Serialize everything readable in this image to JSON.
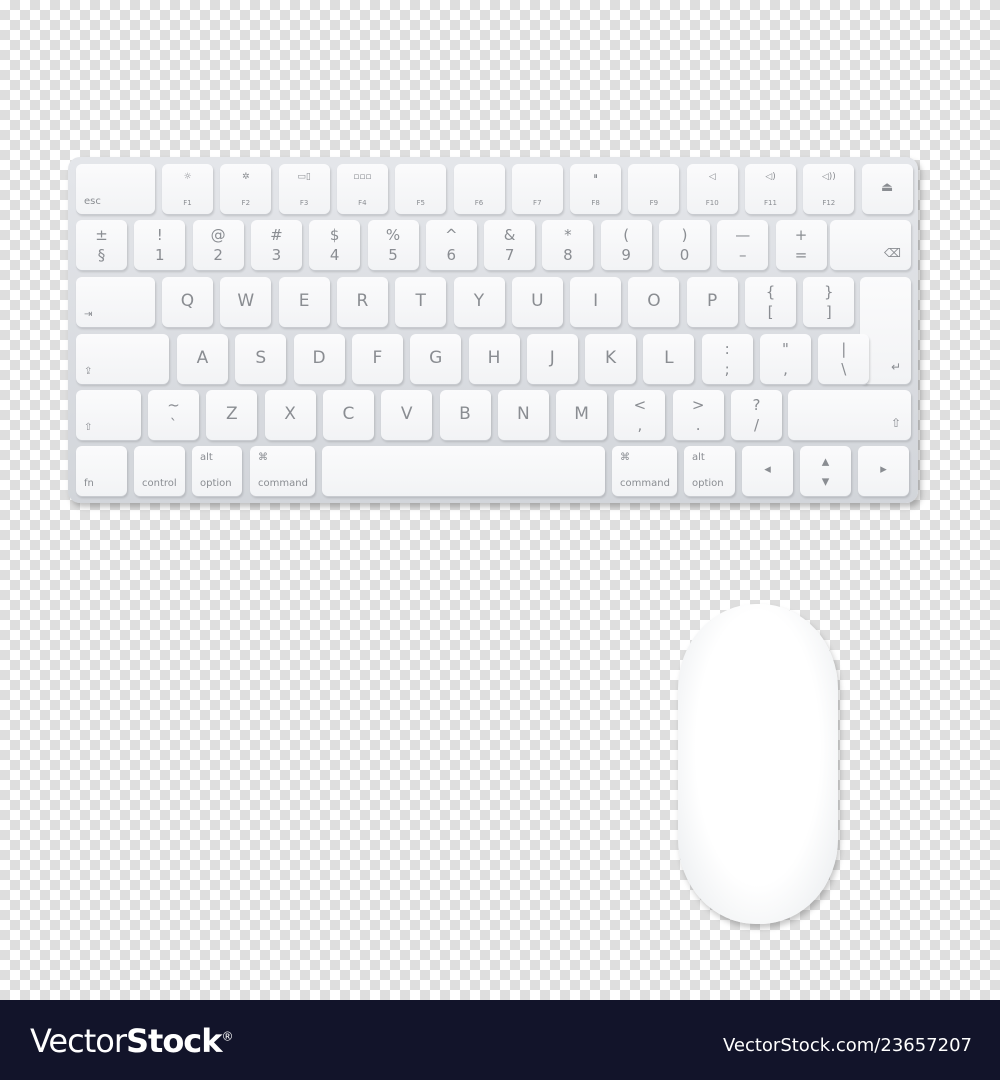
{
  "keyboard": {
    "rows": [
      [
        {
          "bl": "esc"
        },
        {
          "fn": "F1",
          "ico": "☼"
        },
        {
          "fn": "F2",
          "ico": "✲"
        },
        {
          "fn": "F3",
          "ico": "▭▯"
        },
        {
          "fn": "F4",
          "ico": "▫▫▫"
        },
        {
          "fn": "F5"
        },
        {
          "fn": "F6"
        },
        {
          "fn": "F7"
        },
        {
          "fn": "F8",
          "ico": "⏸"
        },
        {
          "fn": "F9"
        },
        {
          "fn": "F10",
          "ico": "◁"
        },
        {
          "fn": "F11",
          "ico": "◁)"
        },
        {
          "fn": "F12",
          "ico": "◁))"
        },
        {
          "cen": "⏏"
        }
      ],
      [
        {
          "top": "±",
          "bot": "§"
        },
        {
          "top": "!",
          "bot": "1"
        },
        {
          "top": "@",
          "bot": "2"
        },
        {
          "top": "#",
          "bot": "3"
        },
        {
          "top": "$",
          "bot": "4"
        },
        {
          "top": "%",
          "bot": "5"
        },
        {
          "top": "^",
          "bot": "6"
        },
        {
          "top": "&",
          "bot": "7"
        },
        {
          "top": "*",
          "bot": "8"
        },
        {
          "top": "(",
          "bot": "9"
        },
        {
          "top": ")",
          "bot": "0"
        },
        {
          "top": "—",
          "bot": "–"
        },
        {
          "top": "+",
          "bot": "="
        },
        {
          "br": "⌫"
        }
      ],
      [
        {
          "bl": "⇥"
        },
        {
          "main": "Q"
        },
        {
          "main": "W"
        },
        {
          "main": "E"
        },
        {
          "main": "R"
        },
        {
          "main": "T"
        },
        {
          "main": "Y"
        },
        {
          "main": "U"
        },
        {
          "main": "I"
        },
        {
          "main": "O"
        },
        {
          "main": "P"
        },
        {
          "top": "{",
          "bot": "["
        },
        {
          "top": "}",
          "bot": "]"
        },
        {
          "br": "↵"
        }
      ],
      [
        {
          "bl": "⇪"
        },
        {
          "main": "A"
        },
        {
          "main": "S"
        },
        {
          "main": "D"
        },
        {
          "main": "F"
        },
        {
          "main": "G"
        },
        {
          "main": "H"
        },
        {
          "main": "J"
        },
        {
          "main": "K"
        },
        {
          "main": "L"
        },
        {
          "top": ":",
          "bot": ";"
        },
        {
          "top": "\"",
          "bot": ","
        },
        {
          "top": "|",
          "bot": "\\"
        }
      ],
      [
        {
          "bl": "⇧"
        },
        {
          "top": "~",
          "bot": "`"
        },
        {
          "main": "Z"
        },
        {
          "main": "X"
        },
        {
          "main": "C"
        },
        {
          "main": "V"
        },
        {
          "main": "B"
        },
        {
          "main": "N"
        },
        {
          "main": "M"
        },
        {
          "top": "<",
          "bot": ","
        },
        {
          "top": ">",
          "bot": "."
        },
        {
          "top": "?",
          "bot": "/"
        },
        {
          "br": "⇧"
        }
      ],
      [
        {
          "bl": "fn"
        },
        {
          "bl": "control"
        },
        {
          "tl": "alt",
          "bl": "option"
        },
        {
          "tl": "⌘",
          "bl": "command"
        },
        {},
        {
          "tl": "⌘",
          "bl": "command"
        },
        {
          "tl": "alt",
          "bl": "option"
        },
        {
          "cen": "◂"
        },
        {
          "top": "▴",
          "bot": "▾"
        },
        {
          "cen": "▸"
        }
      ]
    ]
  },
  "footer": {
    "brand_light": "Vector",
    "brand_bold": "Stock",
    "brand_mark": "®",
    "reference": "VectorStock.com/23657207"
  },
  "colors": {
    "footer_bg": "#12142a",
    "key_text": "#8a8d92"
  }
}
